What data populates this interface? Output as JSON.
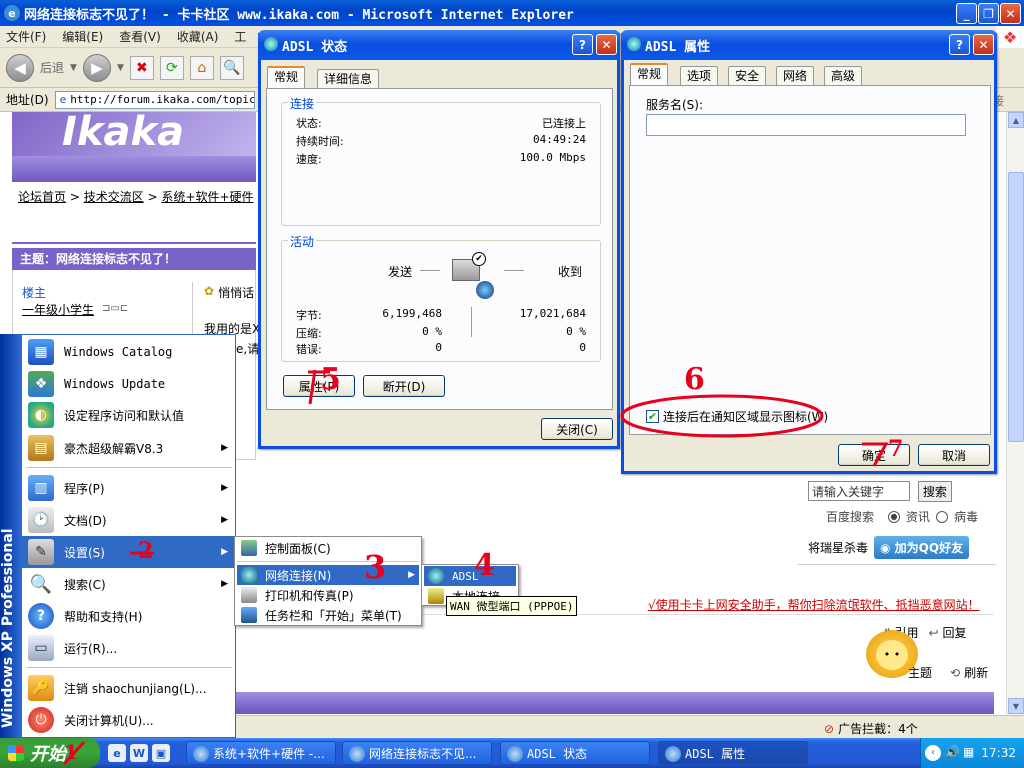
{
  "ie": {
    "title": "网络连接标志不见了！ - 卡卡社区 www.ikaka.com - Microsoft Internet Explorer",
    "menu": [
      "文件(F)",
      "编辑(E)",
      "查看(V)",
      "收藏(A)",
      "工"
    ],
    "back_label": "后退",
    "address_label": "地址(D)",
    "address_value": "http://forum.ikaka.com/topic.a",
    "right_edge_label": "接"
  },
  "page": {
    "banner_text": "Ikaka",
    "breadcrumb": [
      "论坛首页",
      "技术交流区",
      "系统+软件+硬件"
    ],
    "topic": "主题：网络连接标志不见了！",
    "floor_label": "楼主",
    "user_name": "一年级小学生",
    "whisper": "悄悄话",
    "post_text": "我用的是X",
    "post_text2": "e,请",
    "search_placeholder": "请输入关键字",
    "search_button": "搜索",
    "baidu_search": "百度搜索",
    "radio_news": "资讯",
    "radio_virus": "病毒",
    "rising_label": "将瑞星杀毒",
    "qq_button": "加为QQ好友",
    "warn_text": "√使用卡卡上网安全助手，帮你扫除流氓软件、抵挡恶意网站！",
    "quote": "引用",
    "reply": "回复",
    "topic_link": "主题",
    "refresh": "刷新",
    "ad_block": "广告拦截：4个"
  },
  "status_dialog": {
    "title": "ADSL 状态",
    "tabs": [
      "常规",
      "详细信息"
    ],
    "connection_group": "连接",
    "status_label": "状态:",
    "status_value": "已连接上",
    "duration_label": "持续时间:",
    "duration_value": "04:49:24",
    "speed_label": "速度:",
    "speed_value": "100.0 Mbps",
    "activity_group": "活动",
    "sent_label": "发送",
    "received_label": "收到",
    "bytes_label": "字节:",
    "bytes_sent": "6,199,468",
    "bytes_received": "17,021,684",
    "compression_label": "压缩:",
    "compression_sent": "0 %",
    "compression_received": "0 %",
    "errors_label": "错误:",
    "errors_sent": "0",
    "errors_received": "0",
    "properties_button": "属性(P)",
    "disconnect_button": "断开(D)",
    "close_button": "关闭(C)"
  },
  "props_dialog": {
    "title": "ADSL 属性",
    "tabs": [
      "常规",
      "选项",
      "安全",
      "网络",
      "高级"
    ],
    "service_name_label": "服务名(S):",
    "service_name_value": "",
    "notify_checkbox": "连接后在通知区域显示图标(W)",
    "notify_checked": true,
    "ok_button": "确定",
    "cancel_button": "取消"
  },
  "start_menu": {
    "strip_text": "Windows XP Professional",
    "items": [
      {
        "label": "Windows Catalog",
        "icon": "catalog-icon"
      },
      {
        "label": "Windows Update",
        "icon": "update-icon"
      },
      {
        "label": "设定程序访问和默认值",
        "icon": "defaults-icon"
      },
      {
        "label": "豪杰超级解霸V8.3",
        "icon": "program-group-icon"
      },
      {
        "label": "程序(P)",
        "icon": "programs-icon"
      },
      {
        "label": "文档(D)",
        "icon": "documents-icon"
      },
      {
        "label": "设置(S)",
        "icon": "settings-icon"
      },
      {
        "label": "搜索(C)",
        "icon": "search-icon"
      },
      {
        "label": "帮助和支持(H)",
        "icon": "help-icon"
      },
      {
        "label": "运行(R)...",
        "icon": "run-icon"
      },
      {
        "label": "注销 shaochunjiang(L)...",
        "icon": "logoff-icon"
      },
      {
        "label": "关闭计算机(U)...",
        "icon": "shutdown-icon"
      }
    ]
  },
  "settings_submenu": [
    "控制面板(C)",
    "网络连接(N)",
    "打印机和传真(P)",
    "任务栏和「开始」菜单(T)"
  ],
  "network_submenu": [
    "ADSL",
    "本地连接"
  ],
  "tooltip": "WAN 微型端口 (PPPOE)",
  "taskbar": {
    "start": "开始",
    "tasks": [
      "系统+软件+硬件 -...",
      "网络连接标志不见...",
      "ADSL 状态",
      "ADSL 属性"
    ],
    "clock": "17:32"
  },
  "annotations": [
    "1",
    "2",
    "3",
    "4",
    "5",
    "6",
    "7"
  ]
}
